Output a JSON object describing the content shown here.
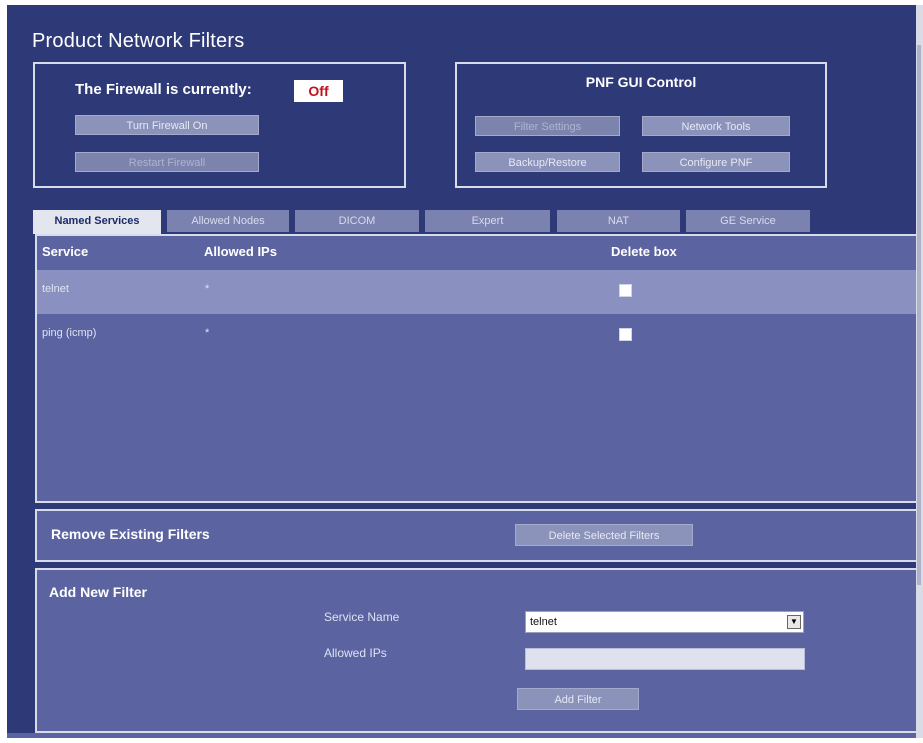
{
  "page": {
    "title": "Product Network Filters"
  },
  "firewall": {
    "label": "The Firewall is currently:",
    "status": "Off",
    "turn_on_button": "Turn Firewall On",
    "restart_button": "Restart Firewall"
  },
  "pnf_control": {
    "title": "PNF GUI Control",
    "filter_settings_button": "Filter Settings",
    "network_tools_button": "Network Tools",
    "backup_restore_button": "Backup/Restore",
    "configure_pnf_button": "Configure PNF"
  },
  "tabs": [
    {
      "label": "Named Services",
      "active": true
    },
    {
      "label": "Allowed Nodes",
      "active": false
    },
    {
      "label": "DICOM",
      "active": false
    },
    {
      "label": "Expert",
      "active": false
    },
    {
      "label": "NAT",
      "active": false
    },
    {
      "label": "GE Service",
      "active": false
    }
  ],
  "services_table": {
    "headers": [
      "Service",
      "Allowed IPs",
      "Delete box"
    ],
    "rows": [
      {
        "service": "telnet",
        "allowed_ips": "*",
        "delete_checked": false
      },
      {
        "service": "ping (icmp)",
        "allowed_ips": "*",
        "delete_checked": false
      }
    ]
  },
  "remove_filters": {
    "title": "Remove Existing Filters",
    "button": "Delete Selected Filters"
  },
  "add_filter": {
    "title": "Add New Filter",
    "service_name_label": "Service Name",
    "service_name_value": "telnet",
    "allowed_ips_label": "Allowed IPs",
    "allowed_ips_value": "",
    "button": "Add Filter"
  },
  "colors": {
    "background": "#2e3a78",
    "panel": "#5b64a0",
    "selected_row": "#8a91c0",
    "status_off": "#c0121b"
  }
}
